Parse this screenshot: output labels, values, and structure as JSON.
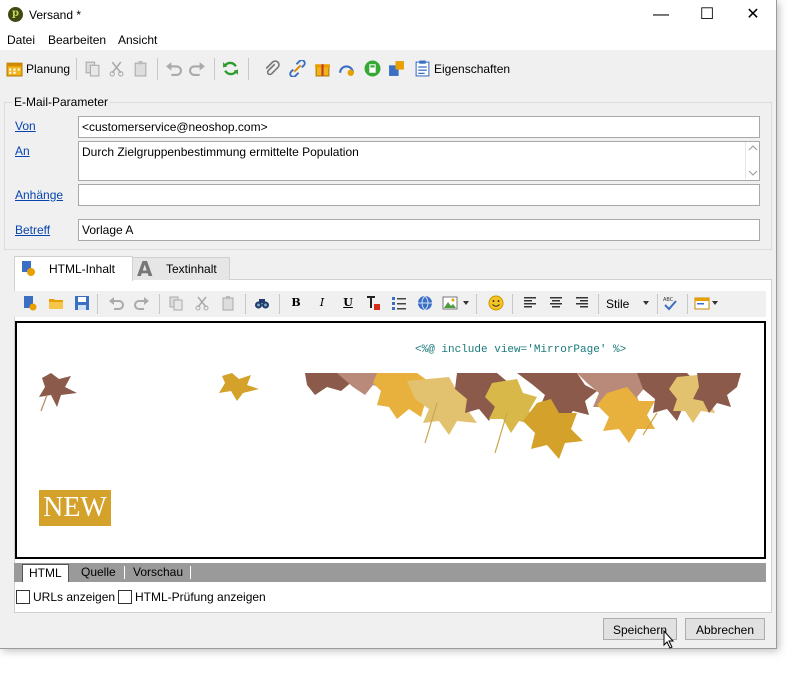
{
  "window": {
    "title": "Versand *",
    "minimize": "—",
    "maximize": "☐",
    "close": "✕"
  },
  "menubar": {
    "items": [
      "Datei",
      "Bearbeiten",
      "Ansicht"
    ]
  },
  "toolbar": {
    "planung_label": "Planung",
    "eigenschaften_label": "Eigenschaften"
  },
  "email_params": {
    "legend": "E-Mail-Parameter",
    "von_label": "Von",
    "von_value": "<customerservice@neoshop.com>",
    "an_label": "An",
    "an_value": "Durch Zielgruppenbestimmung ermittelte Population",
    "anhaenge_label": "Anhänge",
    "anhaenge_value": "",
    "betreff_label": "Betreff",
    "betreff_value": "Vorlage A"
  },
  "content_tabs": {
    "html_label": "HTML-Inhalt",
    "text_label": "Textinhalt",
    "active": "HTML-Inhalt"
  },
  "editor_toolbar": {
    "bold": "B",
    "italic": "I",
    "underline": "U",
    "stile_label": "Stile"
  },
  "canvas": {
    "include_code": "<%@ include view='MirrorPage' %>",
    "new_badge": "NEW"
  },
  "mode_tabs": {
    "items": [
      "HTML",
      "Quelle",
      "Vorschau"
    ],
    "active": "HTML"
  },
  "options": {
    "urls_label": "URLs anzeigen",
    "html_check_label": "HTML-Prüfung anzeigen"
  },
  "buttons": {
    "save_label": "Speichern",
    "cancel_label": "Abbrechen"
  },
  "colors": {
    "link": "#0645ad",
    "accent_gold": "#d4a22b",
    "code_teal": "#1a7a7a"
  }
}
